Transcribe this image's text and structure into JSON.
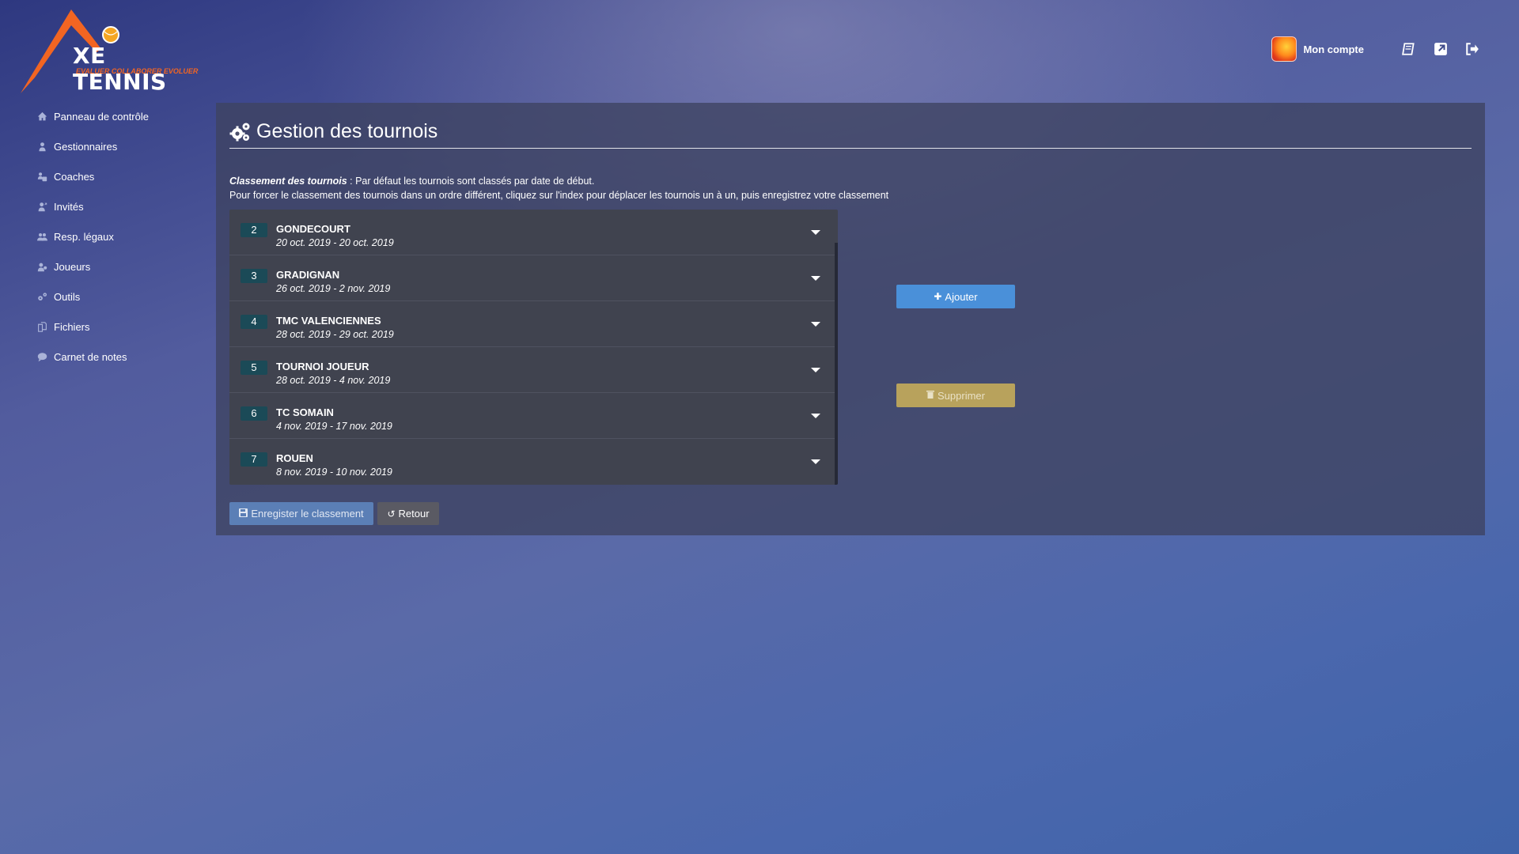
{
  "brand": {
    "name": "XE TENNIS",
    "tagline": "EVALUER COLLABORER EVOLUER"
  },
  "sidebar": {
    "items": [
      {
        "label": "Panneau de contrôle",
        "icon": "home-icon"
      },
      {
        "label": "Gestionnaires",
        "icon": "user-icon"
      },
      {
        "label": "Coaches",
        "icon": "coach-icon"
      },
      {
        "label": "Invités",
        "icon": "guest-icon"
      },
      {
        "label": "Resp. légaux",
        "icon": "users-icon"
      },
      {
        "label": "Joueurs",
        "icon": "players-icon"
      },
      {
        "label": "Outils",
        "icon": "cogs-icon"
      },
      {
        "label": "Fichiers",
        "icon": "files-icon"
      },
      {
        "label": "Carnet de notes",
        "icon": "comment-icon"
      }
    ]
  },
  "topbar": {
    "account_label": "Mon compte",
    "icons": [
      "book-icon",
      "external-link-icon",
      "logout-icon"
    ]
  },
  "page": {
    "title": "Gestion des tournois",
    "info_bold": "Classement des tournois",
    "info_line1": " : Par défaut les tournois sont classés par date de début.",
    "info_line2": "Pour forcer le classement des tournois dans un ordre différent, cliquez sur l'index pour déplacer les tournois un à un, puis enregistrez votre classement"
  },
  "tournaments": [
    {
      "index": "2",
      "name": "GONDECOURT",
      "dates": "20 oct. 2019 - 20 oct. 2019"
    },
    {
      "index": "3",
      "name": "GRADIGNAN",
      "dates": "26 oct. 2019 - 2 nov. 2019"
    },
    {
      "index": "4",
      "name": "TMC VALENCIENNES",
      "dates": "28 oct. 2019 - 29 oct. 2019"
    },
    {
      "index": "5",
      "name": "TOURNOI JOUEUR",
      "dates": "28 oct. 2019 - 4 nov. 2019"
    },
    {
      "index": "6",
      "name": "TC SOMAIN",
      "dates": "4 nov. 2019 - 17 nov. 2019"
    },
    {
      "index": "7",
      "name": "ROUEN",
      "dates": "8 nov. 2019 - 10 nov. 2019"
    }
  ],
  "buttons": {
    "add": "Ajouter",
    "delete": "Supprimer",
    "save": "Enregister le classement",
    "back": "Retour"
  },
  "colors": {
    "add_button": "#4a90d9",
    "delete_button": "#b8a25c",
    "save_button": "#5b7fb6",
    "back_button": "#5a5a63",
    "index_badge": "#1b4a57",
    "brand_orange": "#f26522"
  }
}
